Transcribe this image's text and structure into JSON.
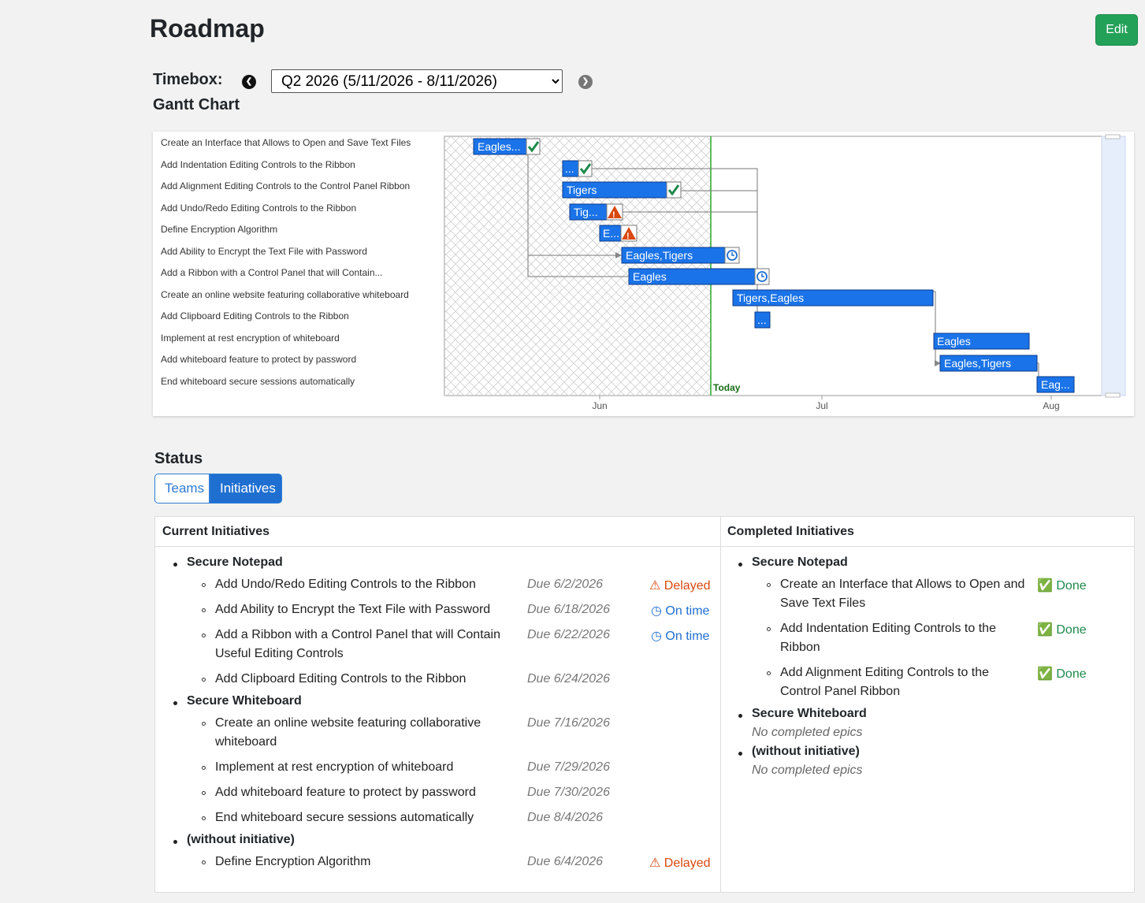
{
  "page": {
    "title": "Roadmap",
    "edit_label": "Edit"
  },
  "timebox": {
    "label": "Timebox:",
    "selected": "Q2 2026 (5/11/2026 - 8/11/2026)"
  },
  "gantt": {
    "title": "Gantt Chart",
    "today_label": "Today",
    "month_labels": [
      "Jun",
      "Jul",
      "Aug"
    ],
    "tasks": [
      {
        "label": "Create an Interface that Allows to Open and Save Text Files",
        "bar": "Eagles...",
        "status": "done"
      },
      {
        "label": "Add Indentation Editing Controls to the Ribbon",
        "bar": "...",
        "status": "done"
      },
      {
        "label": "Add Alignment Editing Controls to the Control Panel Ribbon",
        "bar": "Tigers",
        "status": "done"
      },
      {
        "label": "Add Undo/Redo Editing Controls to the Ribbon",
        "bar": "Tig...",
        "status": "delayed"
      },
      {
        "label": "Define Encryption Algorithm",
        "bar": "E...",
        "status": "delayed"
      },
      {
        "label": "Add Ability to Encrypt the Text File with Password",
        "bar": "Eagles,Tigers",
        "status": "ontime"
      },
      {
        "label": "Add a Ribbon with a Control Panel that will Contain...",
        "bar": "Eagles",
        "status": "ontime"
      },
      {
        "label": "Create an online website featuring collaborative whiteboard",
        "bar": "Tigers,Eagles",
        "status": ""
      },
      {
        "label": "Add Clipboard Editing Controls to the Ribbon",
        "bar": "...",
        "status": ""
      },
      {
        "label": "Implement at rest encryption of whiteboard",
        "bar": "Eagles",
        "status": ""
      },
      {
        "label": "Add whiteboard feature to protect by password",
        "bar": "Eagles,Tigers",
        "status": ""
      },
      {
        "label": "End whiteboard secure sessions automatically",
        "bar": "Eag...",
        "status": ""
      }
    ]
  },
  "status": {
    "title": "Status",
    "toggle": {
      "teams": "Teams",
      "initiatives": "Initiatives"
    },
    "current": {
      "heading": "Current Initiatives",
      "groups": [
        {
          "name": "Secure Notepad",
          "items": [
            {
              "text": "Add Undo/Redo Editing Controls to the Ribbon",
              "due": "Due 6/2/2026",
              "status": "Delayed"
            },
            {
              "text": "Add Ability to Encrypt the Text File with Password",
              "due": "Due 6/18/2026",
              "status": "On time"
            },
            {
              "text1": "Add a Ribbon with a Control Panel that will Contain",
              "text2": "Useful Editing Controls",
              "due": "Due 6/22/2026",
              "status": "On time"
            },
            {
              "text": "Add Clipboard Editing Controls to the Ribbon",
              "due": "Due 6/24/2026",
              "status": ""
            }
          ]
        },
        {
          "name": "Secure Whiteboard",
          "items": [
            {
              "text1": "Create an online website featuring collaborative",
              "text2": "whiteboard",
              "due": "Due 7/16/2026",
              "status": ""
            },
            {
              "text": "Implement at rest encryption of whiteboard",
              "due": "Due 7/29/2026",
              "status": ""
            },
            {
              "text": "Add whiteboard feature to protect by password",
              "due": "Due 7/30/2026",
              "status": ""
            },
            {
              "text": "End whiteboard secure sessions automatically",
              "due": "Due 8/4/2026",
              "status": ""
            }
          ]
        },
        {
          "name": "(without initiative)",
          "items": [
            {
              "text": "Define Encryption Algorithm",
              "due": "Due 6/4/2026",
              "status": "Delayed"
            }
          ]
        }
      ]
    },
    "completed": {
      "heading": "Completed Initiatives",
      "groups": [
        {
          "name": "Secure Notepad",
          "items": [
            {
              "text1": "Create an Interface that Allows to Open and",
              "text2": "Save Text Files",
              "status": "Done"
            },
            {
              "text1": "Add Indentation Editing Controls to the",
              "text2": "Ribbon",
              "status": "Done"
            },
            {
              "text1": "Add Alignment Editing Controls to the",
              "text2": "Control Panel Ribbon",
              "status": "Done"
            }
          ]
        },
        {
          "name": "Secure Whiteboard",
          "empty": "No completed epics"
        },
        {
          "name": "(without initiative)",
          "empty": "No completed epics"
        }
      ]
    }
  },
  "colors": {
    "bar": "#1a73e8",
    "today_line": "#2aa52a",
    "done": "#1e8a4c",
    "delayed": "#d9480f",
    "ontime": "#1f6fd1",
    "edit_button": "#24a159"
  }
}
